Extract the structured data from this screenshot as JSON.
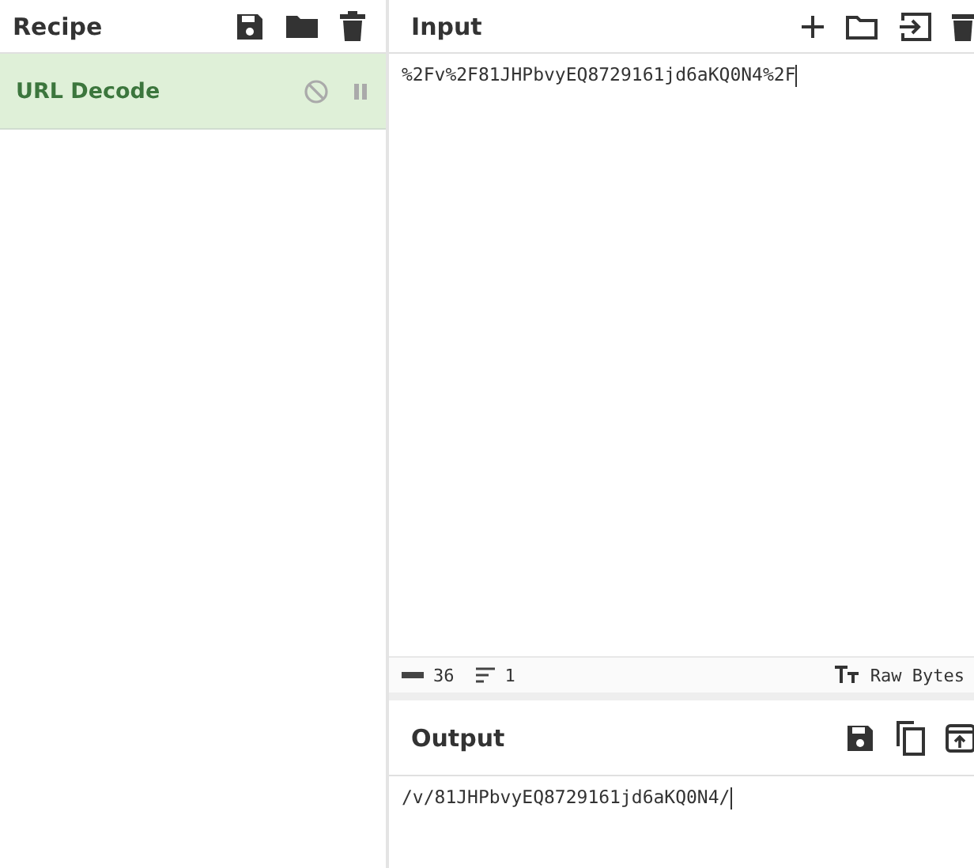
{
  "recipe": {
    "title": "Recipe",
    "operations": [
      {
        "name": "URL Decode",
        "disabled": false,
        "breakpoint": false
      }
    ]
  },
  "input": {
    "title": "Input",
    "value": "%2Fv%2F81JHPbvyEQ8729161jd6aKQ0N4%2F",
    "status": {
      "length": "36",
      "lines": "1",
      "encoding": "Raw Bytes"
    }
  },
  "output": {
    "title": "Output",
    "value": "/v/81JHPbvyEQ8729161jd6aKQ0N4/"
  }
}
